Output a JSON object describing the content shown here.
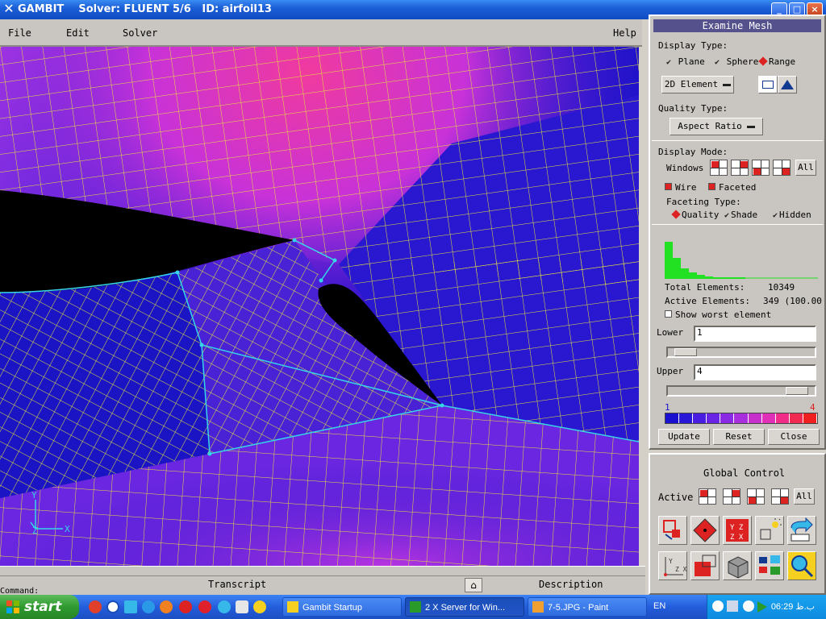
{
  "window": {
    "title": "GAMBIT    Solver: FLUENT 5/6   ID: airfoil13",
    "controls": {
      "minimize": "_",
      "maximize": "□",
      "close": "×"
    }
  },
  "menu": {
    "file": "File",
    "edit": "Edit",
    "solver": "Solver",
    "help": "Help"
  },
  "viewport": {
    "axis_y": "Y",
    "axis_z": "Z",
    "axis_x": "X",
    "colors": {
      "low": "#1d12c8",
      "mid": "#7a2ee8",
      "high": "#e23ab0",
      "grid": "#e8e83a",
      "edge": "#36d6e8"
    }
  },
  "bottom": {
    "transcript": "Transcript",
    "description": "Description",
    "command_prompt": "Command:"
  },
  "examine": {
    "header": "Examine Mesh",
    "display_type_label": "Display Type:",
    "display_types": [
      {
        "label": "Plane",
        "selected": false
      },
      {
        "label": "Sphere",
        "selected": false
      },
      {
        "label": "Range",
        "selected": true
      }
    ],
    "element_dropdown": "2D Element",
    "quality_type_label": "Quality Type:",
    "quality_dropdown": "Aspect Ratio",
    "display_mode_label": "Display Mode:",
    "windows_label": "Windows",
    "all_label": "All",
    "wire_label": "Wire",
    "wire_checked": true,
    "faceted_label": "Faceted",
    "faceted_checked": true,
    "faceting_type_label": "Faceting Type:",
    "faceting_types": [
      {
        "label": "Quality",
        "selected": true
      },
      {
        "label": "Shade",
        "selected": false
      },
      {
        "label": "Hidden",
        "selected": false
      }
    ],
    "histogram": [
      28,
      16,
      8,
      5,
      3,
      2,
      1,
      1,
      1,
      1
    ],
    "total_label": "Total Elements:",
    "total_value": "10349",
    "active_label": "Active Elements:",
    "active_value": "349 (100.00",
    "worst_label": "Show worst element",
    "lower_label": "Lower",
    "lower_value": "1",
    "lower_slider": 0.05,
    "upper_label": "Upper",
    "upper_value": "4",
    "upper_slider": 0.95,
    "scale_min": "1",
    "scale_max": "4",
    "scale_colors": [
      "#1a10d0",
      "#2a18d8",
      "#4a1ee0",
      "#6a24e4",
      "#8a2ae4",
      "#a82ede",
      "#c830cc",
      "#e030b8",
      "#f02c88",
      "#f02a50",
      "#f02020"
    ],
    "update": "Update",
    "reset": "Reset",
    "close": "Close"
  },
  "global_control": {
    "title": "Global Control",
    "active_label": "Active",
    "all_label": "All"
  },
  "taskbar": {
    "start": "start",
    "tasks": [
      {
        "label": "Gambit Startup",
        "active": false
      },
      {
        "label": "2 X Server for Win...",
        "active": true
      },
      {
        "label": "7-5.JPG - Paint",
        "active": false
      }
    ],
    "lang": "EN",
    "time": "06:29 ب.ظ"
  }
}
